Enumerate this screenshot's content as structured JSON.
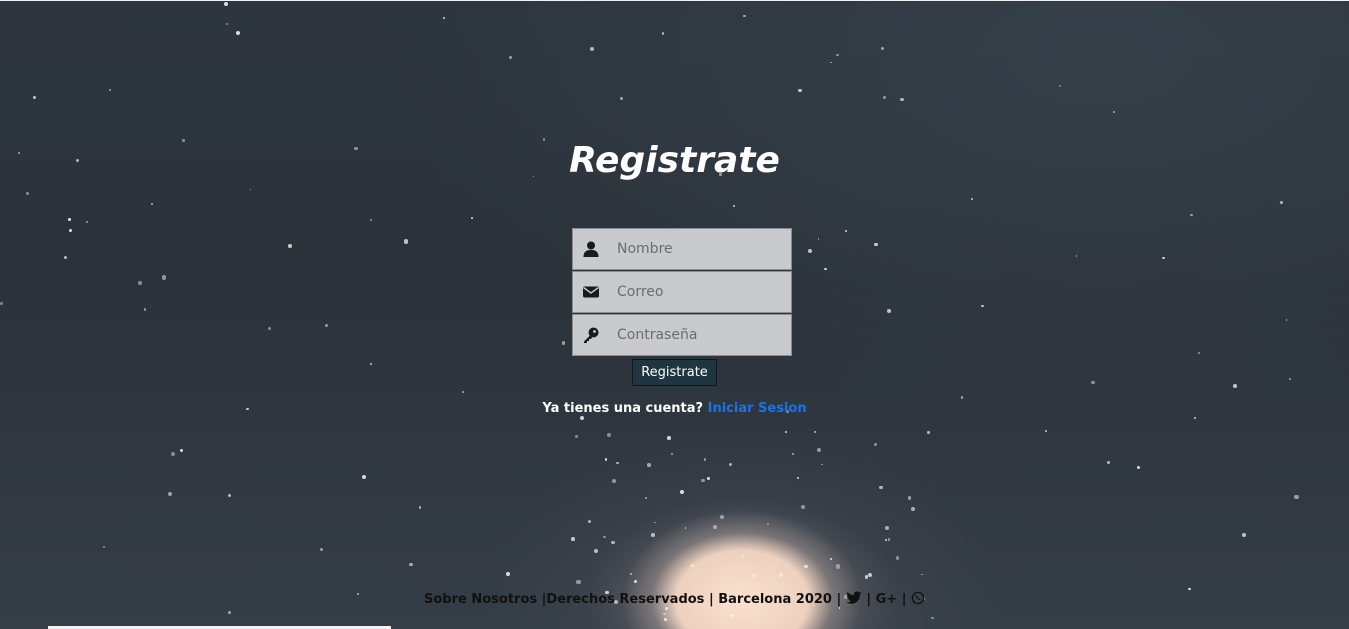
{
  "page": {
    "title": "Registrate"
  },
  "form": {
    "name_placeholder": "Nombre",
    "email_placeholder": "Correo",
    "password_placeholder": "Contraseña",
    "submit_label": "Registrate"
  },
  "login_prompt": {
    "text": "Ya tienes una cuenta?",
    "link_label": "Iniciar Sesion"
  },
  "footer": {
    "about": "Sobre Nosotros",
    "rights": "Derechos Reservados",
    "location": "Barcelona 2020",
    "googleplus": "G+",
    "icons": [
      "twitter-icon",
      "whatsapp-icon"
    ]
  },
  "colors": {
    "link": "#1a73e8",
    "button_bg": "#1f3640",
    "field_bg": "#c8cacd"
  }
}
